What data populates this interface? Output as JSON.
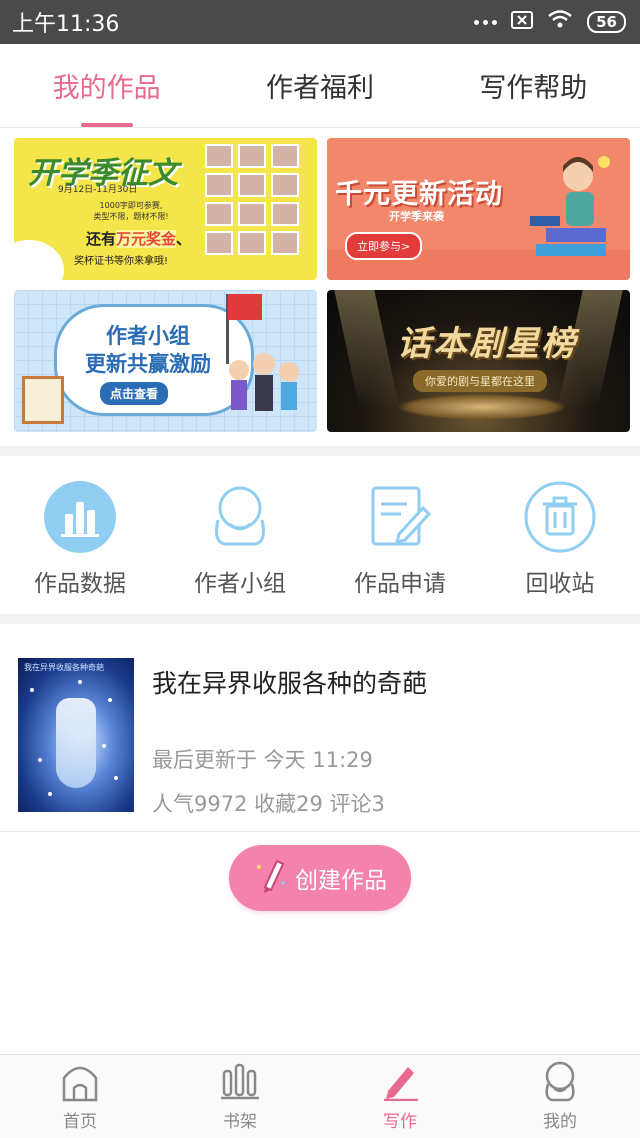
{
  "status_bar": {
    "time": "上午11:36",
    "battery": "56"
  },
  "tabs": [
    {
      "label": "我的作品",
      "active": true
    },
    {
      "label": "作者福利",
      "active": false
    },
    {
      "label": "写作帮助",
      "active": false
    }
  ],
  "banners": {
    "b1": {
      "title": "开学季征文",
      "date": "9月12日-11月30日",
      "line1": "1000字即可参赛,",
      "line2": "类型不限，题材不限!",
      "bonus_prefix": "还有",
      "bonus_highlight": "万元奖金",
      "bonus_suffix": "、",
      "cert": "奖杯证书等你来拿哦!"
    },
    "b2": {
      "title": "千元更新活动",
      "subtitle": "开学季来袭",
      "button": "立即参与>"
    },
    "b3": {
      "title_line1": "作者小组",
      "title_line2": "更新共赢激励",
      "button": "点击查看"
    },
    "b4": {
      "title": "话本剧星榜",
      "subtitle": "你爱的剧与星都在这里"
    }
  },
  "quick_actions": [
    {
      "label": "作品数据",
      "icon": "bar-chart-icon"
    },
    {
      "label": "作者小组",
      "icon": "group-avatar-icon"
    },
    {
      "label": "作品申请",
      "icon": "edit-document-icon"
    },
    {
      "label": "回收站",
      "icon": "trash-icon"
    }
  ],
  "work": {
    "title": "我在异界收服各种的奇葩",
    "cover_caption": "我在异界收服各种奇葩",
    "updated": "最后更新于 今天 11:29",
    "stats": "人气9972 收藏29 评论3"
  },
  "create_button": {
    "label": "创建作品"
  },
  "bottom_nav": [
    {
      "label": "首页",
      "icon": "home-icon",
      "active": false
    },
    {
      "label": "书架",
      "icon": "bookshelf-icon",
      "active": false
    },
    {
      "label": "写作",
      "icon": "pen-icon",
      "active": true
    },
    {
      "label": "我的",
      "icon": "profile-icon",
      "active": false
    }
  ],
  "colors": {
    "accent": "#e86a8e",
    "create_button": "#f382ad",
    "icon_blue": "#7fc3ea"
  }
}
